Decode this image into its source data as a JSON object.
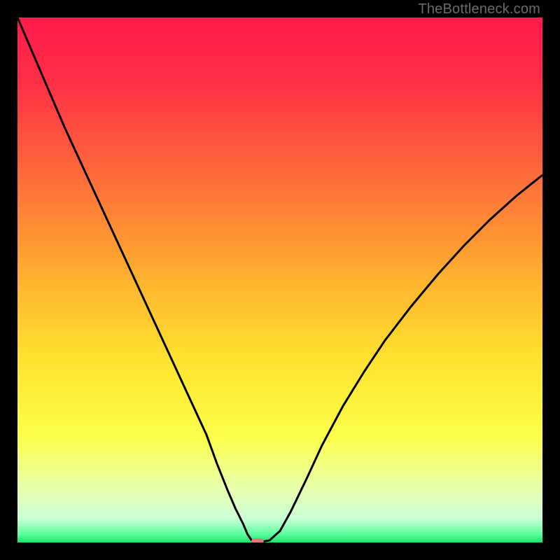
{
  "watermark": "TheBottleneck.com",
  "accent_marker_color": "#d87a82",
  "chart_data": {
    "type": "line",
    "title": "",
    "xlabel": "",
    "ylabel": "",
    "xlim": [
      0,
      100
    ],
    "ylim": [
      0,
      100
    ],
    "grid": false,
    "legend": false,
    "background_gradient_stops": [
      {
        "offset": 0.0,
        "color": "#ff1a4b"
      },
      {
        "offset": 0.12,
        "color": "#ff2e47"
      },
      {
        "offset": 0.3,
        "color": "#ff6a3a"
      },
      {
        "offset": 0.5,
        "color": "#ffb22f"
      },
      {
        "offset": 0.65,
        "color": "#ffe22e"
      },
      {
        "offset": 0.8,
        "color": "#fbff4a"
      },
      {
        "offset": 0.9,
        "color": "#e7ffb0"
      },
      {
        "offset": 0.955,
        "color": "#caffd6"
      },
      {
        "offset": 0.985,
        "color": "#57ff9a"
      },
      {
        "offset": 1.0,
        "color": "#17e56b"
      }
    ],
    "series": [
      {
        "name": "bottleneck-curve",
        "x": [
          0,
          3,
          6,
          9,
          12,
          15,
          18,
          21,
          24,
          27,
          30,
          33,
          36,
          38,
          40,
          41.5,
          43,
          43.8,
          44.6,
          45.7,
          48,
          50,
          52,
          55,
          58,
          62,
          66,
          70,
          75,
          80,
          85,
          90,
          95,
          100
        ],
        "y": [
          100,
          93,
          86,
          79,
          72.5,
          66,
          59.5,
          53,
          46.5,
          40,
          33.5,
          27,
          20.5,
          15,
          10,
          6.5,
          3.5,
          1.6,
          0.4,
          0,
          0.4,
          2.2,
          5.8,
          12,
          18.5,
          26,
          32.5,
          38.5,
          45,
          51,
          56.5,
          61.5,
          66,
          70
        ]
      }
    ],
    "marker": {
      "x": 45.7,
      "y": 0,
      "w": 2.4,
      "h": 1.6
    }
  }
}
